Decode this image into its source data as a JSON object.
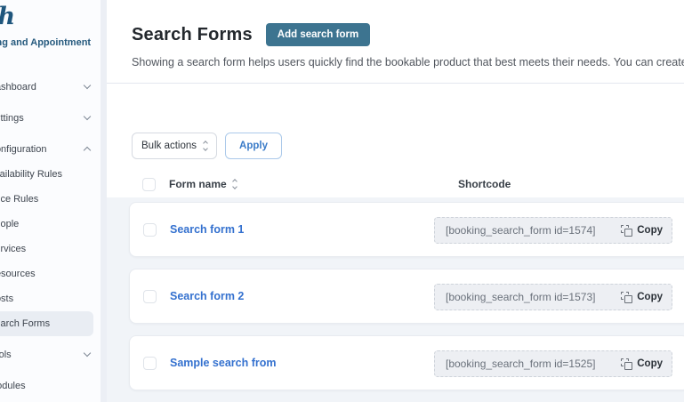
{
  "sidebar": {
    "logo_text": "ch",
    "subtitle": "Booking and Appointment",
    "items": [
      {
        "label": "Dashboard"
      },
      {
        "label": "Settings"
      },
      {
        "label": "Configuration"
      },
      {
        "label": "Availability Rules"
      },
      {
        "label": "Price Rules"
      },
      {
        "label": "People"
      },
      {
        "label": "Services"
      },
      {
        "label": "Resources"
      },
      {
        "label": "Costs"
      },
      {
        "label": "Search Forms"
      },
      {
        "label": "Tools"
      },
      {
        "label": "Modules"
      }
    ]
  },
  "header": {
    "title": "Search Forms",
    "add_button_label": "Add search form",
    "description": "Showing a search form helps users quickly find the bookable product that best meets their needs. You can create endless search forms which"
  },
  "toolbar": {
    "bulk_actions_label": "Bulk actions",
    "apply_label": "Apply"
  },
  "table": {
    "columns": {
      "name": "Form name",
      "shortcode": "Shortcode"
    },
    "rows": [
      {
        "name": "Search form 1",
        "shortcode": "[booking_search_form id=1574]",
        "copy_label": "Copy"
      },
      {
        "name": "Search form 2",
        "shortcode": "[booking_search_form id=1573]",
        "copy_label": "Copy"
      },
      {
        "name": "Sample search from",
        "shortcode": "[booking_search_form id=1525]",
        "copy_label": "Copy"
      }
    ]
  },
  "colors": {
    "accent_button": "#3d7490",
    "link_blue": "#3471cf",
    "apply_blue": "#3a7bc8",
    "logo_blue": "#1f567d",
    "rows_background": "#f1f4f8",
    "pill_background": "#edeff3"
  }
}
